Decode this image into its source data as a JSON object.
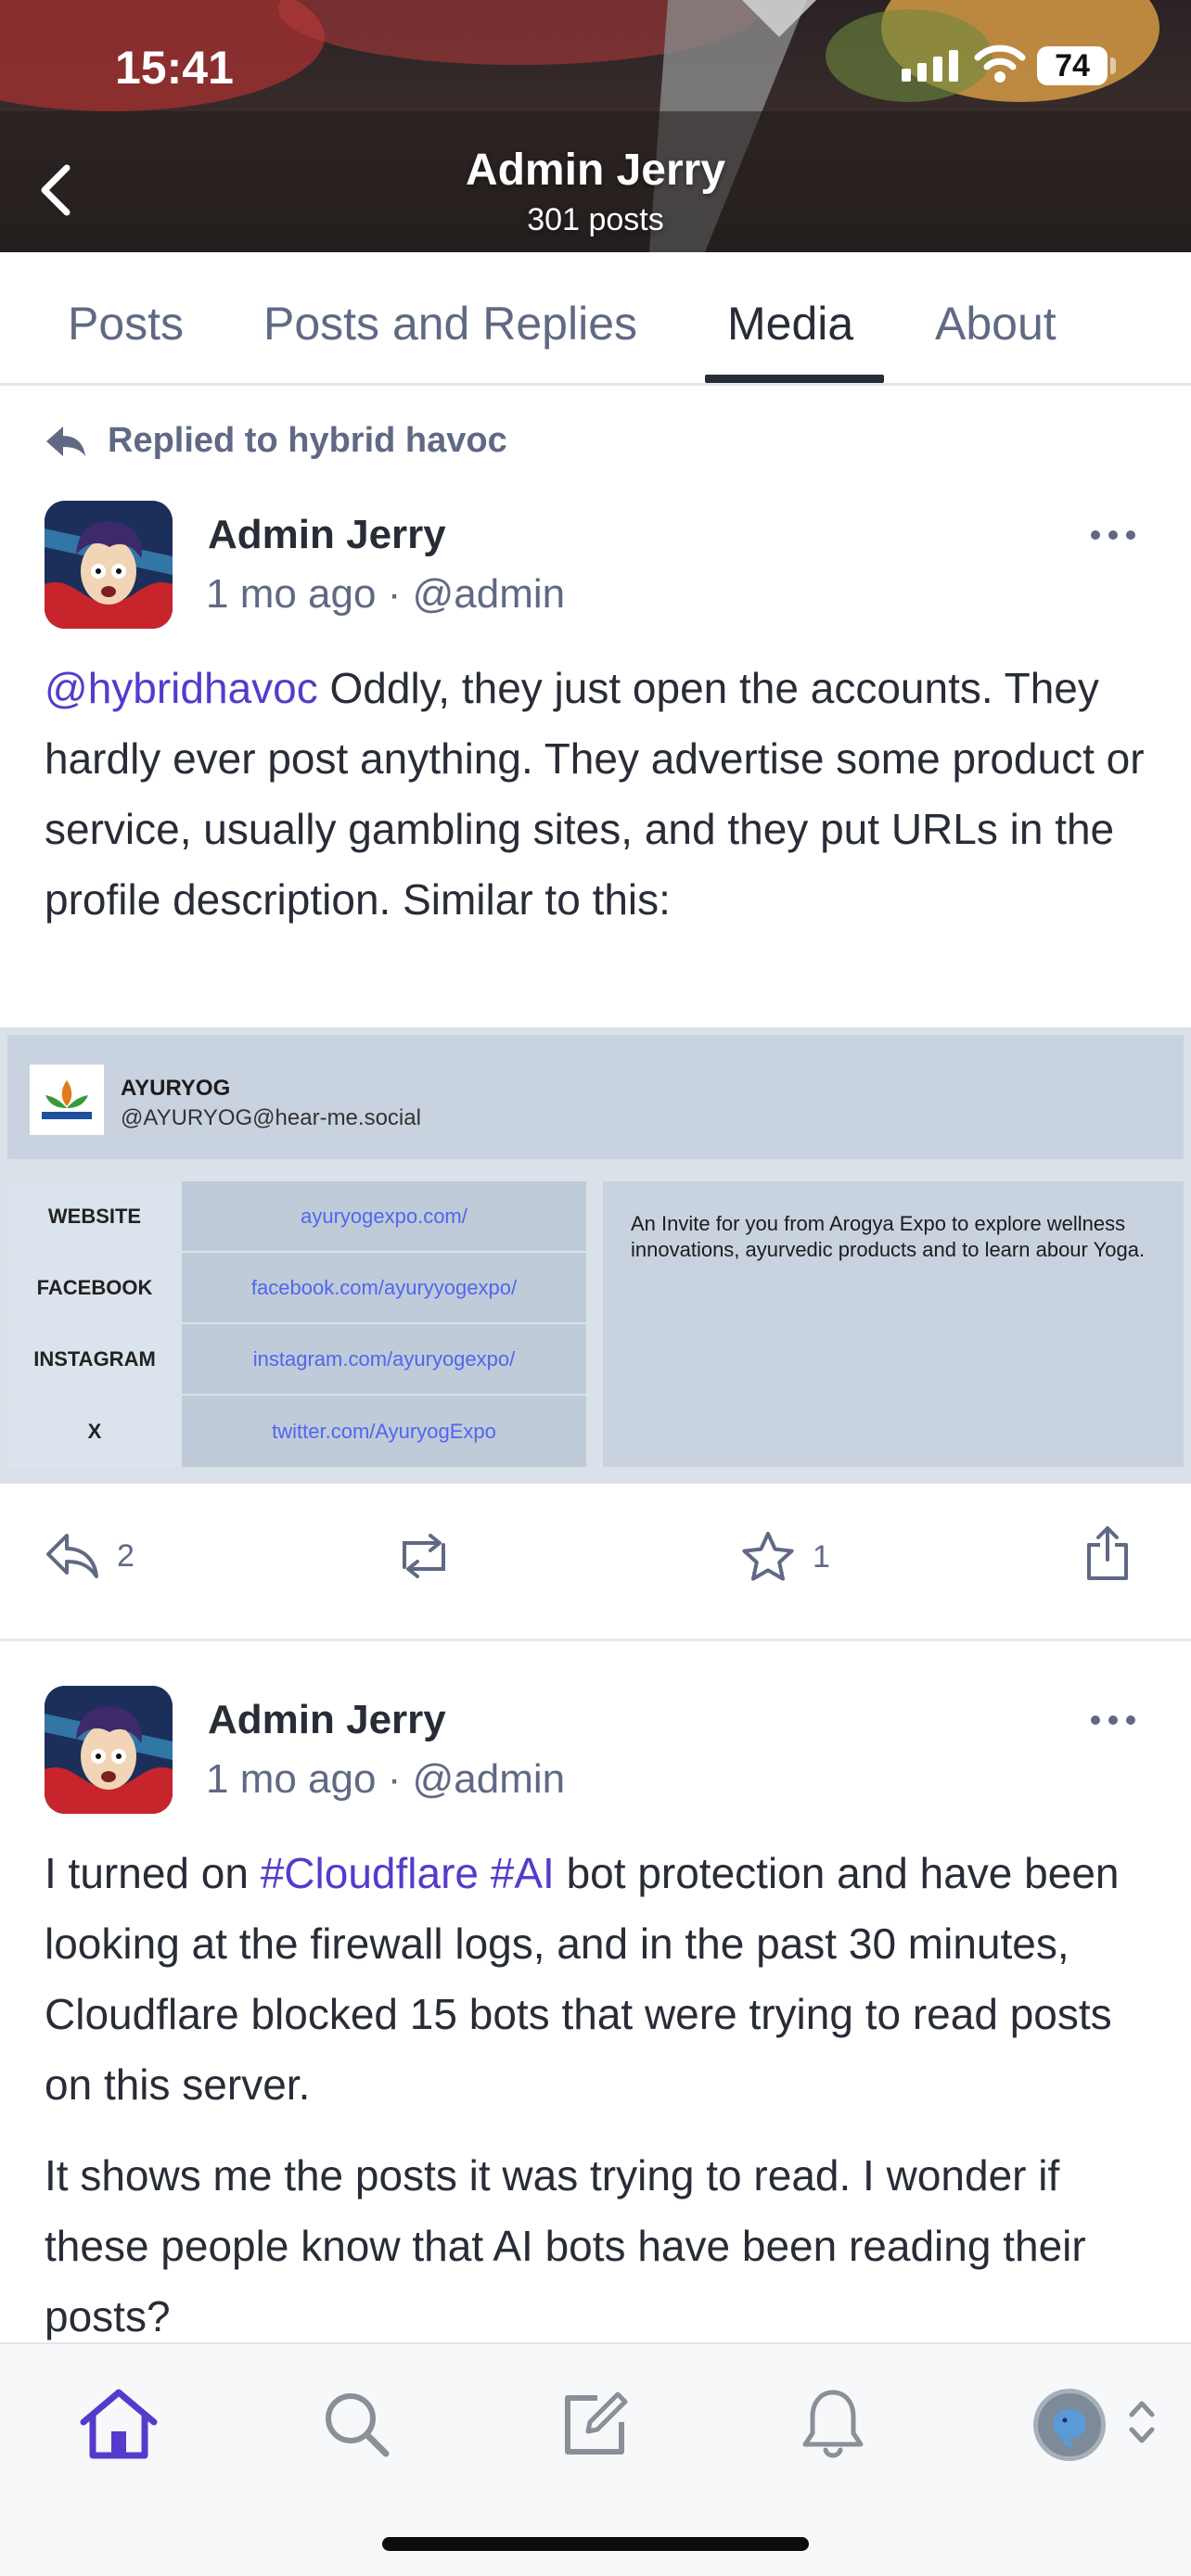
{
  "status_bar": {
    "time": "15:41",
    "battery": "74"
  },
  "profile": {
    "name": "Admin Jerry",
    "posts_count": "301 posts"
  },
  "tabs": [
    {
      "label": "Posts",
      "active": false
    },
    {
      "label": "Posts and Replies",
      "active": false
    },
    {
      "label": "Media",
      "active": true
    },
    {
      "label": "About",
      "active": false
    }
  ],
  "posts": [
    {
      "reply_to": "Replied to hybrid havoc",
      "author": "Admin Jerry",
      "time": "1 mo ago",
      "handle": "@admin",
      "mention": "@hybridhavoc",
      "text": " Oddly, they just open the accounts. They hardly ever post anything. They advertise some product or service, usually gambling sites, and they put URLs in the profile description. Similar to this:",
      "media": {
        "name": "AYURYOG",
        "handle": "@AYURYOG@hear-me.social",
        "rows": [
          {
            "label": "WEBSITE",
            "value": "ayuryogexpo.com/"
          },
          {
            "label": "FACEBOOK",
            "value": "facebook.com/ayuryyogexpo/"
          },
          {
            "label": "INSTAGRAM",
            "value": "instagram.com/ayuryogexpo/"
          },
          {
            "label": "X",
            "value": "twitter.com/AyuryogExpo"
          }
        ],
        "description": "An Invite for you from Arogya Expo to explore wellness innovations, ayurvedic products and to learn abour Yoga."
      },
      "reply_count": "2",
      "favourite_count": "1"
    },
    {
      "author": "Admin Jerry",
      "time": "1 mo ago",
      "handle": "@admin",
      "p1_a": "I turned on ",
      "hashtag1": "#Cloudflare",
      "p1_space": " ",
      "hashtag2": "#AI",
      "p1_b": " bot protection and have been looking at the firewall logs, and in the past 30 minutes, Cloudflare blocked 15 bots that were trying to read posts on this server.",
      "p2": "It shows me the posts it was trying to read. I wonder if these people know that AI bots have been reading their posts?"
    }
  ],
  "colors": {
    "accent": "#563acc",
    "secondary_text": "#606984",
    "primary_text": "#282c37"
  },
  "icons": {
    "back": "chevron-left-icon",
    "reply": "reply-icon",
    "boost": "boost-icon",
    "favourite": "star-icon",
    "share": "share-icon",
    "home": "home-icon",
    "search": "search-icon",
    "compose": "compose-icon",
    "notifications": "bell-icon"
  }
}
